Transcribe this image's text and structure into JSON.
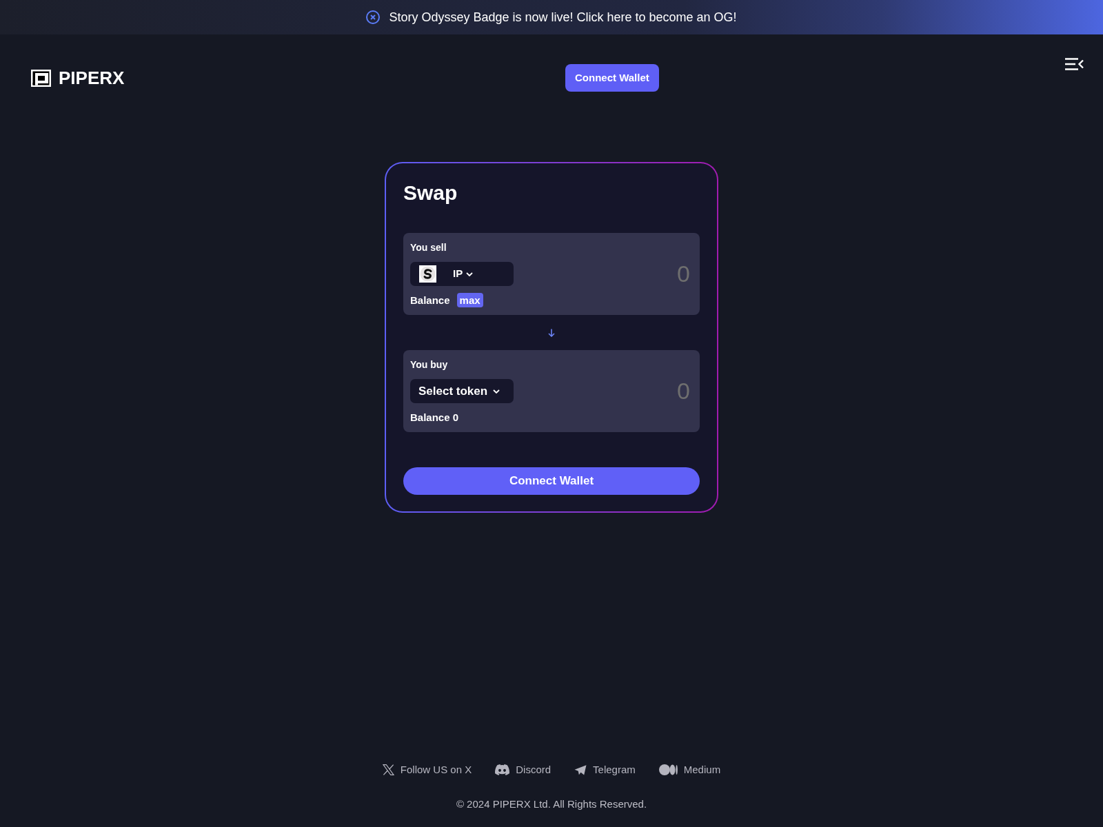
{
  "announcement": {
    "text": "Story Odyssey Badge is now live! Click here to become an OG!"
  },
  "header": {
    "logo_text": "PIPERX",
    "connect_button": "Connect Wallet"
  },
  "swap": {
    "title": "Swap",
    "panels": [
      {
        "label": "You sell",
        "token_selector": {
          "kind": "token",
          "label": "IP"
        },
        "amount": {
          "placeholder": "0"
        },
        "balance": "Balance",
        "max_button": "max"
      },
      {
        "label": "You buy",
        "token_selector": {
          "kind": "prompt",
          "label": "Select token"
        },
        "amount": {
          "placeholder": "0"
        },
        "balance": "Balance 0"
      }
    ],
    "submit_button": "Connect Wallet"
  },
  "footer": {
    "links": [
      {
        "kind": "x",
        "label": "Follow US on X"
      },
      {
        "kind": "discord",
        "label": "Discord"
      },
      {
        "kind": "telegram",
        "label": "Telegram"
      },
      {
        "kind": "medium",
        "label": "Medium"
      }
    ],
    "copyright": "© 2024 PIPERX Ltd. All Rights Reserved."
  }
}
